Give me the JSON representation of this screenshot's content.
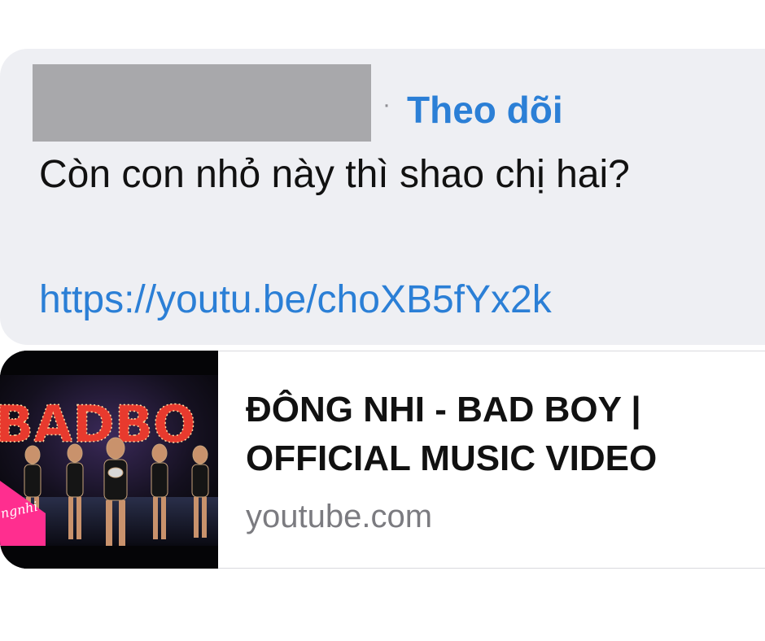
{
  "comment": {
    "separator": "·",
    "follow_label": "Theo dõi",
    "text": "Còn con nhỏ này thì shao chị hai?",
    "link": "https://youtu.be/choXB5fYx2k"
  },
  "link_preview": {
    "title": "ĐÔNG NHI - BAD BOY | OFFICIAL MUSIC VIDEO",
    "domain": "youtube.com",
    "thumbnail_sign": "BADBO",
    "thumbnail_logo": "ngnhi"
  },
  "colors": {
    "link": "#2b7fd6",
    "bubble": "#eeeff3",
    "redaction": "#a8a8ab"
  }
}
